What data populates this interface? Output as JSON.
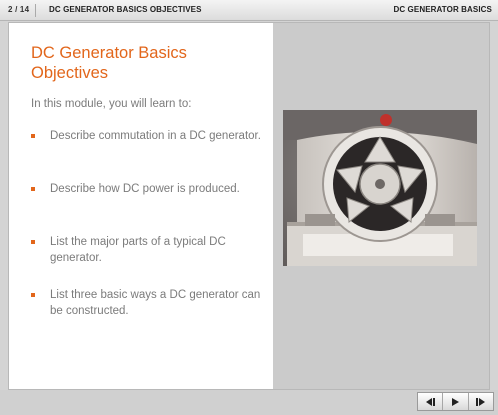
{
  "topbar": {
    "page_counter": "2 / 14",
    "slide_title": "DC GENERATOR BASICS OBJECTIVES",
    "course_title": "DC GENERATOR BASICS"
  },
  "content": {
    "heading": "DC Generator Basics Objectives",
    "intro": "In this module, you will learn to:",
    "objectives": [
      "Describe commutation in a DC generator.",
      "Describe how DC power is produced.",
      "List the major parts of a typical DC generator.",
      "List three basic ways a DC generator can be constructed."
    ]
  },
  "media": {
    "icon": "dc-generator-photo"
  },
  "nav": {
    "icons": [
      "rewind-icon",
      "play-icon",
      "next-icon"
    ]
  },
  "colors": {
    "accent": "#e2661b",
    "body_text": "#7b7b7b",
    "right_panel": "#cbcbcb"
  }
}
